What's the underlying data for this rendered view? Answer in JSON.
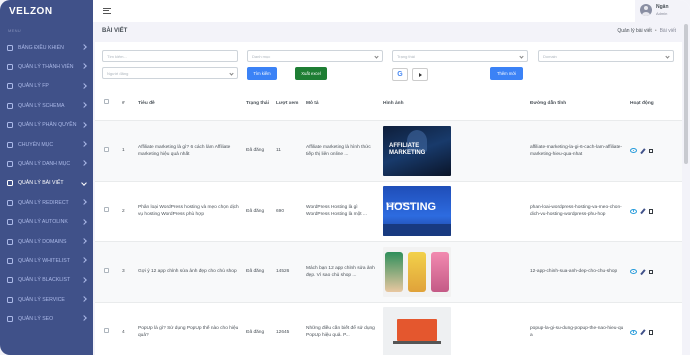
{
  "app": {
    "logo": "VELZON"
  },
  "sidebar": {
    "menu_title": "MENU",
    "items": [
      {
        "label": "BẢNG ĐIỀU KHIỂN",
        "icon": "dashboard-icon"
      },
      {
        "label": "QUẢN LÝ THÀNH VIÊN",
        "icon": "users-icon"
      },
      {
        "label": "QUẢN LÝ FP",
        "icon": "grid-icon"
      },
      {
        "label": "QUẢN LÝ SCHEMA",
        "icon": "schema-icon"
      },
      {
        "label": "QUẢN LÝ PHÂN QUYỀN",
        "icon": "lock-icon"
      },
      {
        "label": "CHUYÊN MỤC",
        "icon": "folder-icon"
      },
      {
        "label": "QUẢN LÝ DANH MỤC",
        "icon": "list-icon"
      },
      {
        "label": "QUẢN LÝ BÀI VIẾT",
        "icon": "article-icon",
        "active": true
      },
      {
        "label": "QUẢN LÝ REDIRECT",
        "icon": "redirect-icon"
      },
      {
        "label": "QUẢN LÝ AUTOLINK",
        "icon": "link-icon"
      },
      {
        "label": "QUẢN LÝ DOMAINS",
        "icon": "globe-icon"
      },
      {
        "label": "QUẢN LÝ WHITELIST",
        "icon": "check-icon"
      },
      {
        "label": "QUẢN LÝ BLACKLIST",
        "icon": "block-icon"
      },
      {
        "label": "QUẢN LÝ SERVICE",
        "icon": "service-icon"
      },
      {
        "label": "QUẢN LÝ SEO",
        "icon": "seo-icon"
      }
    ]
  },
  "user": {
    "name": "Ngân",
    "role": "Admin"
  },
  "page": {
    "title": "BÀI VIẾT",
    "breadcrumb": [
      "Quản lý bài viết",
      "Bài viết"
    ]
  },
  "filters": {
    "search_placeholder": "Tìm kiếm...",
    "category_placeholder": "Danh mục",
    "status_placeholder": "Trạng thái",
    "domain_placeholder": "Domain",
    "author_placeholder": "Người đăng",
    "filter_button": "Tìm kiếm",
    "export_button": "Xuất excel",
    "google_label": "G",
    "add_button": "Thêm mới"
  },
  "table": {
    "headers": [
      "#",
      "Tiêu đề",
      "Trạng thái",
      "Lượt xem",
      "Mô tả",
      "Hình ảnh",
      "Đường dẫn tĩnh",
      "Hoạt động"
    ],
    "rows": [
      {
        "id": "1",
        "title": "Affiliate marketing là gì? 6 cách làm Affiliate marketing hiệu quả nhất",
        "status": "Đã đăng",
        "views": "11",
        "desc": "Affiliate marketing là hình thức tiếp thị liên online ...",
        "image_text": "AFFILIATE MARKETING",
        "slug": "affiliate-marketing-la-gi-6-cach-lam-affiliate-marketing-hieu-qua-nhat"
      },
      {
        "id": "2",
        "title": "Phân loại WordPress hosting và mẹo chọn dịch vụ hosting WordPress phù hợp",
        "status": "Đã đăng",
        "views": "690",
        "desc": "WordPress Hosting là gì WordPress Hosting là một ...",
        "image_text": "HOSTING",
        "image_sub": "WORDPRESS",
        "slug": "phan-loai-wordpress-hosting-va-meo-chon-dich-vu-hosting-wordpress-phu-hop"
      },
      {
        "id": "3",
        "title": "Gợi ý 12 app chỉnh sửa ảnh đẹp cho chủ shop",
        "status": "Đã đăng",
        "views": "14526",
        "desc": "Mách bạn 12 app chỉnh sửa ảnh đẹp. Vì sao chủ shop ...",
        "slug": "12-app-chinh-sua-anh-dep-cho-chu-shop"
      },
      {
        "id": "4",
        "title": "PopUp là gì? Sử dụng PopUp thế nào cho hiệu quả?",
        "status": "Đã đăng",
        "views": "12645",
        "desc": "Những điều cần biết để sử dụng PopUp hiệu quả. P...",
        "slug": "popup-la-gi-su-dung-popup-the-nao-hieu-qua"
      }
    ]
  }
}
